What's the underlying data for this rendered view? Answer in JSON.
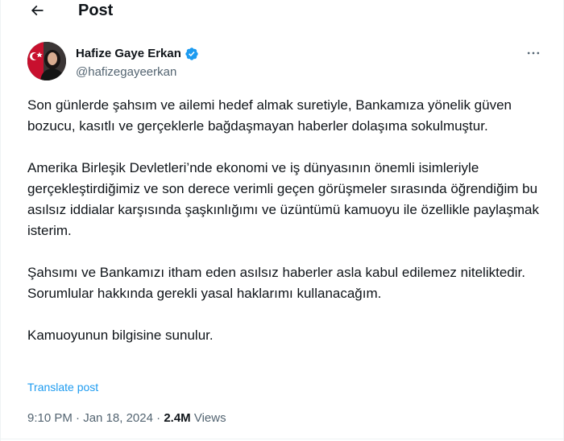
{
  "header": {
    "title": "Post"
  },
  "author": {
    "name": "Hafize Gaye Erkan",
    "handle": "@hafizegayeerkan"
  },
  "post": {
    "paragraphs": [
      "Son günlerde şahsım ve ailemi hedef almak suretiyle, Bankamıza yönelik güven bozucu, kasıtlı ve gerçeklerle bağdaşmayan haberler dolaşıma sokulmuştur.",
      "Amerika Birleşik Devletleri’nde ekonomi ve iş dünyasının önemli isimleriyle gerçekleştirdiğimiz ve son derece verimli geçen görüşmeler sırasında öğrendiğim bu asılsız iddialar karşısında şaşkınlığımı ve üzüntümü kamuoyu ile özellikle paylaşmak isterim.",
      "Şahsımı ve Bankamızı itham eden asılsız haberler asla kabul edilemez niteliktedir. Sorumlular hakkında gerekli yasal haklarımı kullanacağım.",
      "Kamuoyunun bilgisine sunulur."
    ],
    "translate_label": "Translate post",
    "time": "9:10 PM",
    "date": "Jan 18, 2024",
    "separator": "·",
    "views_count": "2.4M",
    "views_label": "Views"
  },
  "colors": {
    "accent": "#1d9bf0",
    "secondary_text": "#536471",
    "text": "#0f1419"
  },
  "icons": {
    "back": "arrow-left-icon",
    "verified": "verified-badge-icon",
    "more": "more-horizontal-icon"
  }
}
